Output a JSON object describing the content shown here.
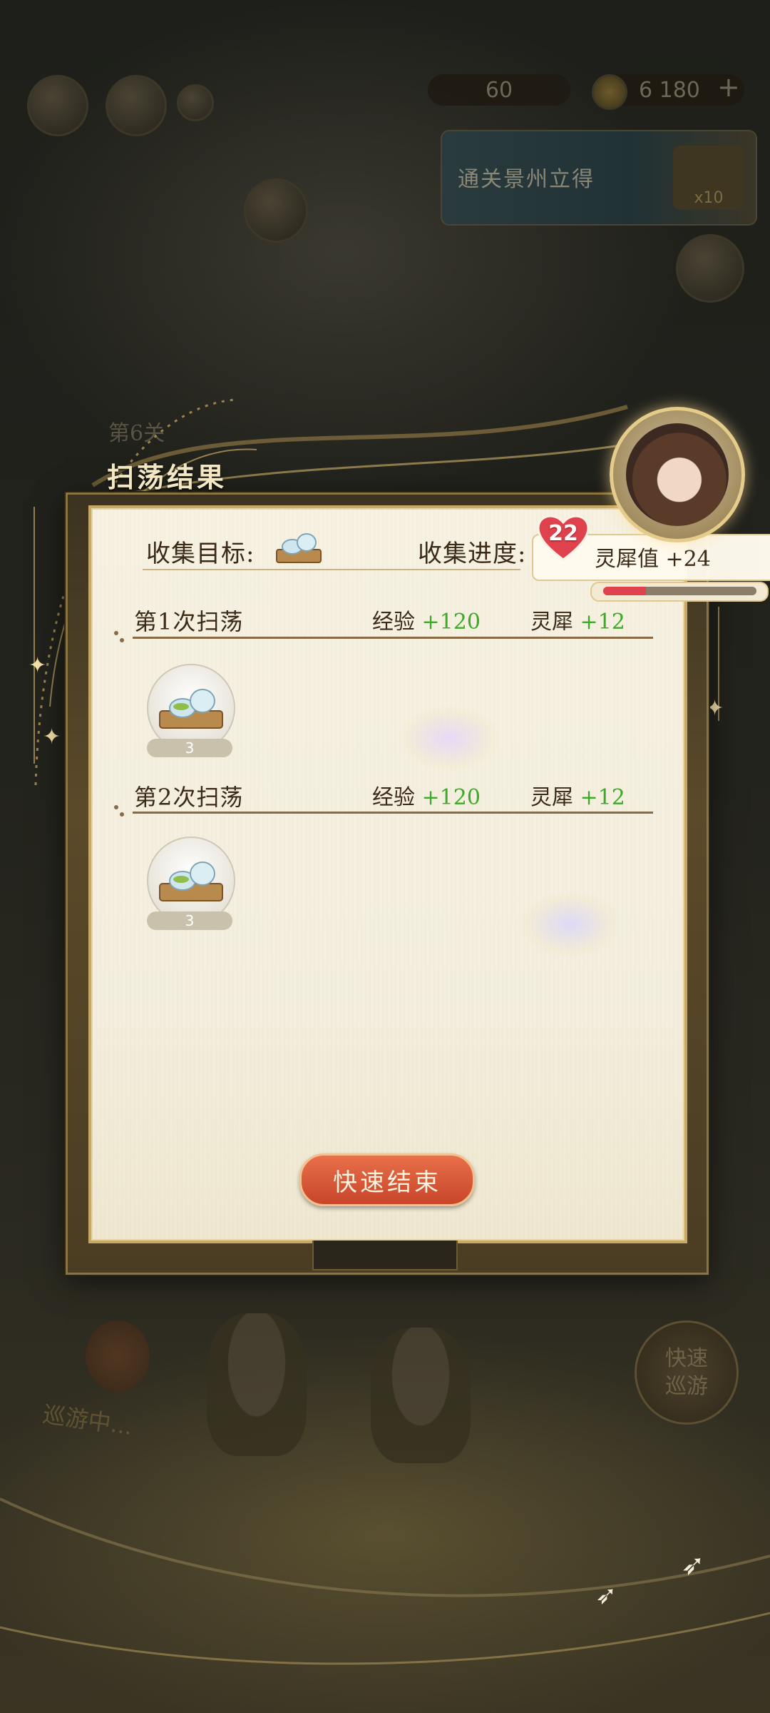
{
  "hud": {
    "stat_left_value": "60",
    "stat_right_value": "6 180",
    "plus_icon": "+",
    "banner_text": "通关景州立得",
    "banner_badge": "x10"
  },
  "background": {
    "level_label": "第6关",
    "roaming_status": "巡游中...",
    "quick_roam_line1": "快速",
    "quick_roam_line2": "巡游"
  },
  "modal": {
    "title": "扫荡结果",
    "collect_target_label": "收集目标:",
    "collect_progress_label": "收集进度:",
    "sweeps": [
      {
        "label": "第1次扫荡",
        "exp_label": "经验",
        "exp_value": "+120",
        "lingxi_label": "灵犀",
        "lingxi_value": "+12",
        "item_icon": "tea-set-icon",
        "item_count": "3"
      },
      {
        "label": "第2次扫荡",
        "exp_label": "经验",
        "exp_value": "+120",
        "lingxi_label": "灵犀",
        "lingxi_value": "+12",
        "item_icon": "tea-set-icon",
        "item_count": "3"
      }
    ],
    "quick_end_button": "快速结束"
  },
  "affection": {
    "level": "22",
    "label": "灵犀值 +24",
    "progress": 0.28
  },
  "colors": {
    "accent_green": "#3faa2a",
    "button_red": "#d9573a",
    "heart_red": "#e0424d",
    "frame_gold": "#c9a865"
  }
}
